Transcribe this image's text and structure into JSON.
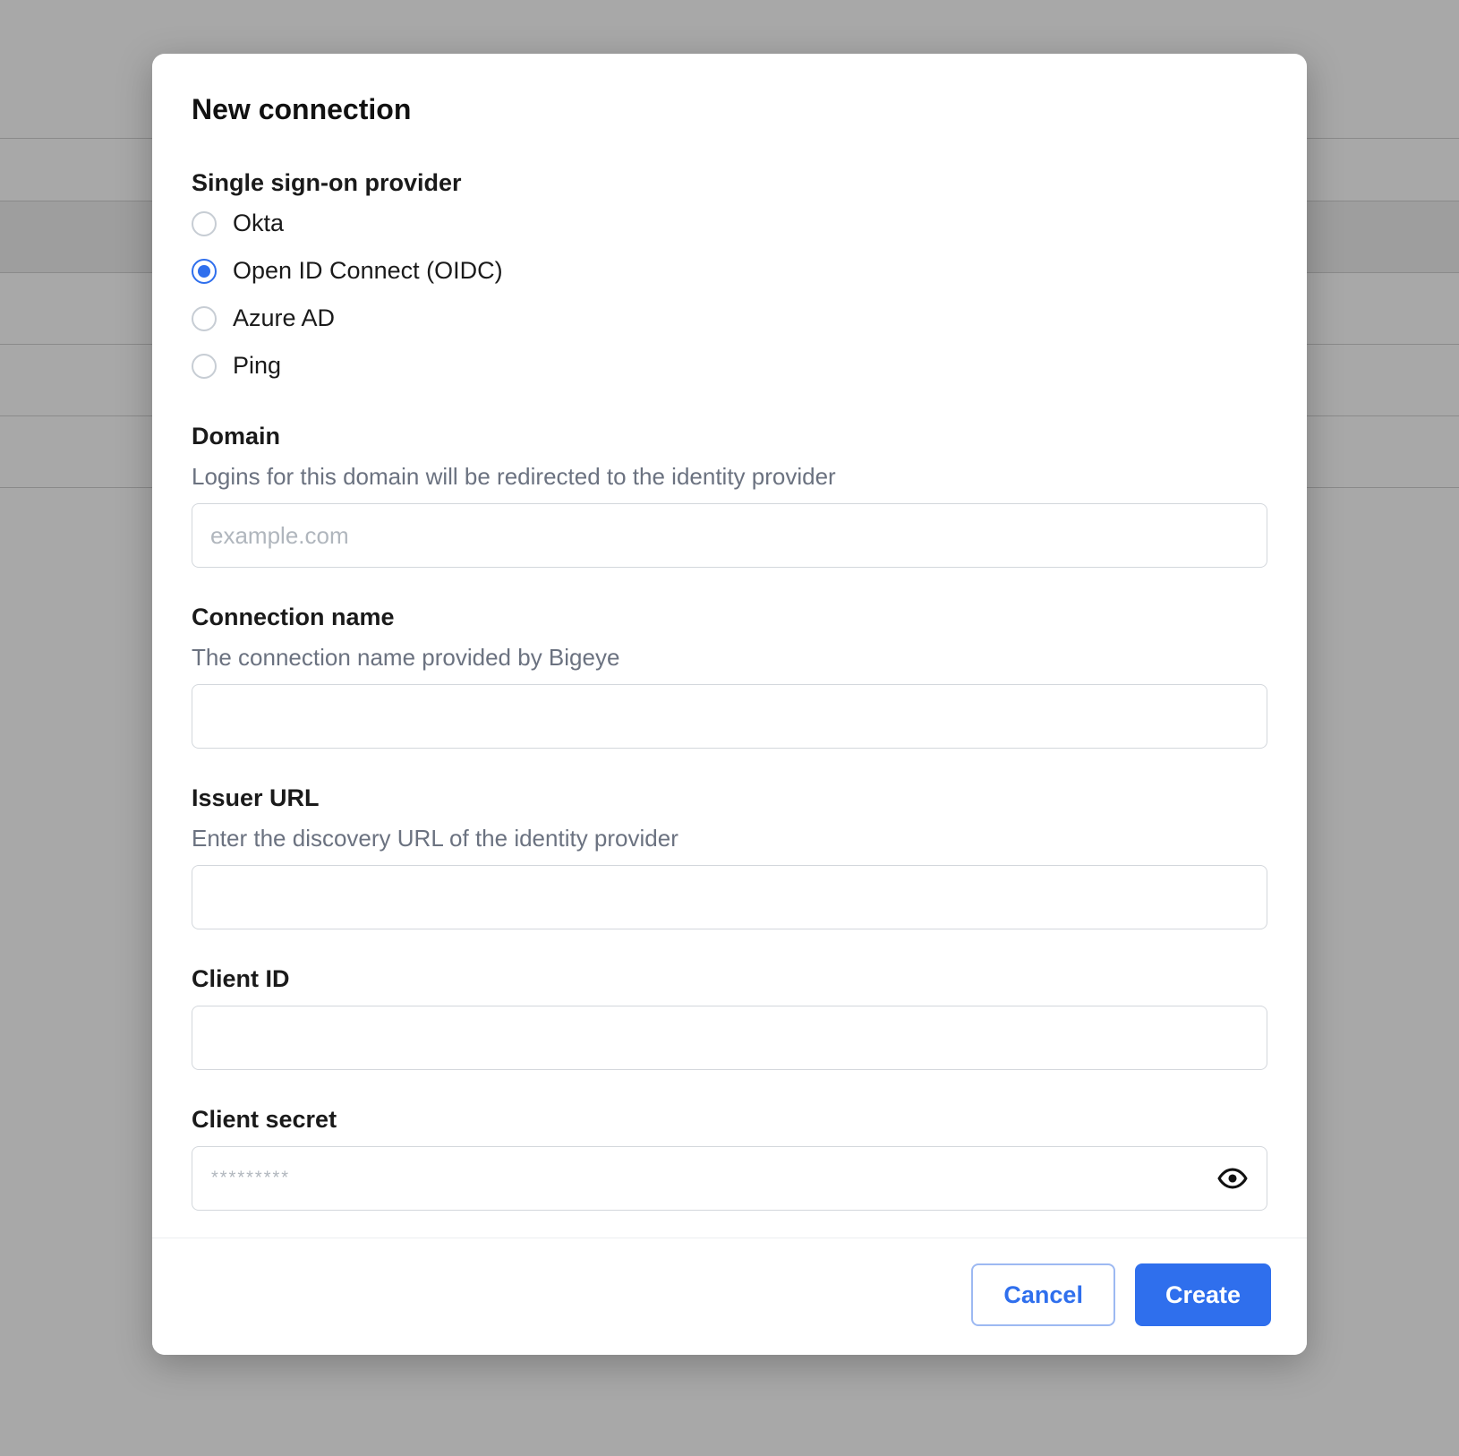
{
  "modal": {
    "title": "New connection",
    "provider_section": {
      "label": "Single sign-on provider",
      "options": [
        {
          "id": "okta",
          "label": "Okta",
          "selected": false
        },
        {
          "id": "oidc",
          "label": "Open ID Connect (OIDC)",
          "selected": true
        },
        {
          "id": "azure_ad",
          "label": "Azure AD",
          "selected": false
        },
        {
          "id": "ping",
          "label": "Ping",
          "selected": false
        }
      ]
    },
    "fields": {
      "domain": {
        "label": "Domain",
        "helper": "Logins for this domain will be redirected to the identity provider",
        "placeholder": "example.com",
        "value": ""
      },
      "connection_name": {
        "label": "Connection name",
        "helper": "The connection name provided by Bigeye",
        "placeholder": "",
        "value": ""
      },
      "issuer_url": {
        "label": "Issuer URL",
        "helper": "Enter the discovery URL of the identity provider",
        "placeholder": "",
        "value": ""
      },
      "client_id": {
        "label": "Client ID",
        "helper": "",
        "placeholder": "",
        "value": ""
      },
      "client_secret": {
        "label": "Client secret",
        "helper": "",
        "mask": "*********",
        "value": ""
      }
    },
    "footer": {
      "cancel_label": "Cancel",
      "create_label": "Create"
    }
  }
}
